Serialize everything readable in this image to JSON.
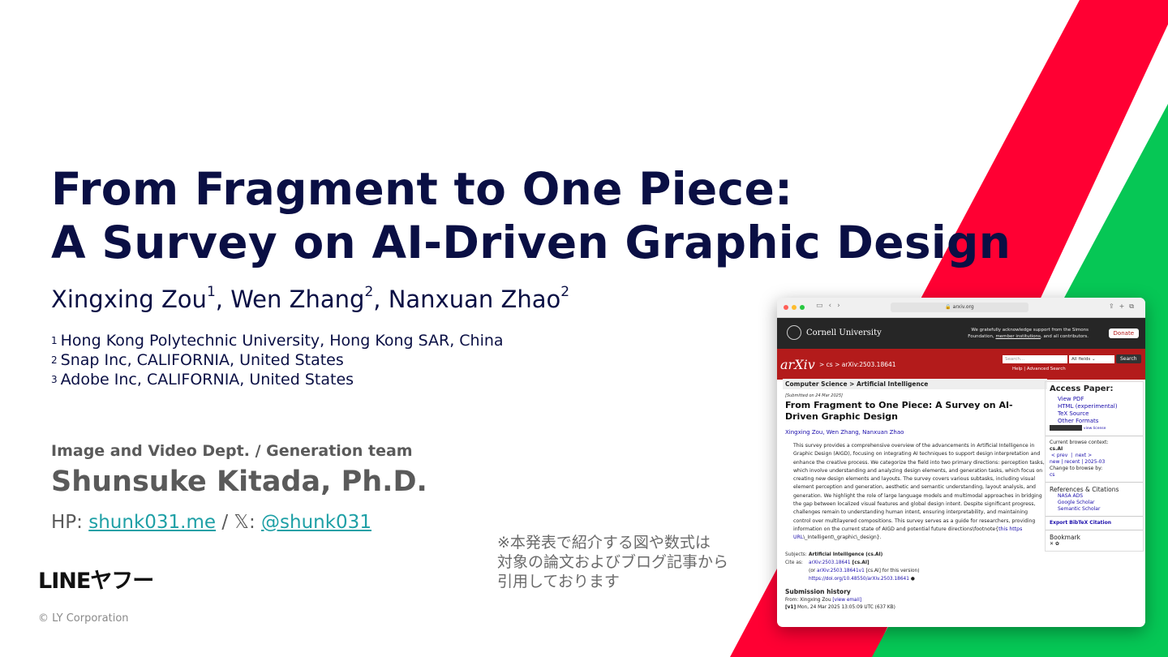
{
  "title": {
    "line1": "From Fragment to One Piece:",
    "line2": "A Survey on AI-Driven Graphic Design"
  },
  "authors": [
    {
      "name": "Xingxing Zou",
      "sup": "1",
      "sep": ", "
    },
    {
      "name": "Wen Zhang",
      "sup": "2",
      "sep": ", "
    },
    {
      "name": "Nanxuan Zhao",
      "sup": "2",
      "sep": ""
    }
  ],
  "affiliations": [
    {
      "num": "1",
      "text": "Hong Kong Polytechnic University, Hong Kong SAR, China"
    },
    {
      "num": "2",
      "text": "Snap Inc, CALIFORNIA, United States"
    },
    {
      "num": "3",
      "text": "Adobe Inc, CALIFORNIA, United States"
    }
  ],
  "dept": "Image and Video Dept. / Generation team",
  "presenter": "Shunsuke Kitada, Ph.D.",
  "contact": {
    "hp_label": "HP: ",
    "hp_link": "shunk031.me",
    "sep": " / ",
    "x_label": "𝕏: ",
    "x_link": "@shunk031"
  },
  "logo": "LINEヤフー",
  "copyright": "© LY Corporation",
  "note": [
    "※本発表で紹介する図や数式は",
    "対象の論文およびブログ記事から",
    "引用しております"
  ],
  "colors": {
    "red": "#ff0033",
    "green": "#06c755",
    "navy": "#0a0f44",
    "link": "#1ea0a6"
  },
  "browser": {
    "url": "arxiv.org",
    "cornell": "Cornell University",
    "ack_line1": "We gratefully acknowledge support from the Simons",
    "ack_line2a": "Foundation, ",
    "ack_line2b": "member institutions",
    "ack_line2c": ", and all contributors.",
    "donate": "Donate",
    "arxiv_logo": "arXiv",
    "crumb": "> cs > arXiv:2503.18641",
    "search_placeholder": "Search...",
    "field_select": "All fields",
    "search_btn": "Search",
    "help_links": "Help | Advanced Search",
    "subject_bar": "Computer Science > Artificial Intelligence",
    "submitted": "[Submitted on 24 Mar 2025]",
    "paper_title": "From Fragment to One Piece: A Survey on AI-Driven Graphic Design",
    "paper_authors": "Xingxing Zou, Wen Zhang, Nanxuan Zhao",
    "abstract_1": "This survey provides a comprehensive overview of the advancements in Artificial Intelligence in Graphic Design (AIGD), focusing on integrating AI techniques to support design interpretation and enhance the creative process. We categorize the field into two primary directions: perception tasks, which involve understanding and analyzing design elements, and generation tasks, which focus on creating new design elements and layouts. The survey covers various subtasks, including visual element perception and generation, aesthetic and semantic understanding, layout analysis, and generation. We highlight the role of large language models and multimodal approaches in bridging the gap between localized visual features and global design intent. Despite significant progress, challenges remain to understanding human intent, ensuring interpretability, and maintaining control over multilayered compositions. This survey serves as a guide for researchers, providing information on the current state of AIGD and potential future directions\\footnote{",
    "abstract_link": "this https URL",
    "abstract_2": "\\_Intelligent\\_graphic\\_design}.",
    "subjects_label": "Subjects:",
    "subjects_value": "Artificial Intelligence (cs.AI)",
    "cite_label": "Cite as:",
    "cite_id": "arXiv:2503.18641",
    "cite_cat": " [cs.AI]",
    "cite_or_a": "(or ",
    "cite_v1": "arXiv:2503.18641v1",
    "cite_or_b": " [cs.AI] for this version)",
    "doi": "https://doi.org/10.48550/arXiv.2503.18641",
    "history_title": "Submission history",
    "from_text": "From: Xingxing Zou ",
    "view_email": "[view email]",
    "v1_label": "[v1]",
    "v1_text": " Mon, 24 Mar 2025 13:05:09 UTC (637 KB)",
    "access_title": "Access Paper:",
    "access_links": [
      "View PDF",
      "HTML (experimental)",
      "TeX Source",
      "Other Formats"
    ],
    "view_license": "view license",
    "browse_context": "Current browse context:",
    "browse_cat": "cs.AI",
    "prev": "< prev",
    "next": "next >",
    "new_recent": "new | recent | 2025-03",
    "change_browse": "Change to browse by:",
    "browse_cs": "cs",
    "refs_title": "References & Citations",
    "refs": [
      "NASA ADS",
      "Google Scholar",
      "Semantic Scholar"
    ],
    "bibtex": "Export BibTeX Citation",
    "bookmark": "Bookmark"
  }
}
